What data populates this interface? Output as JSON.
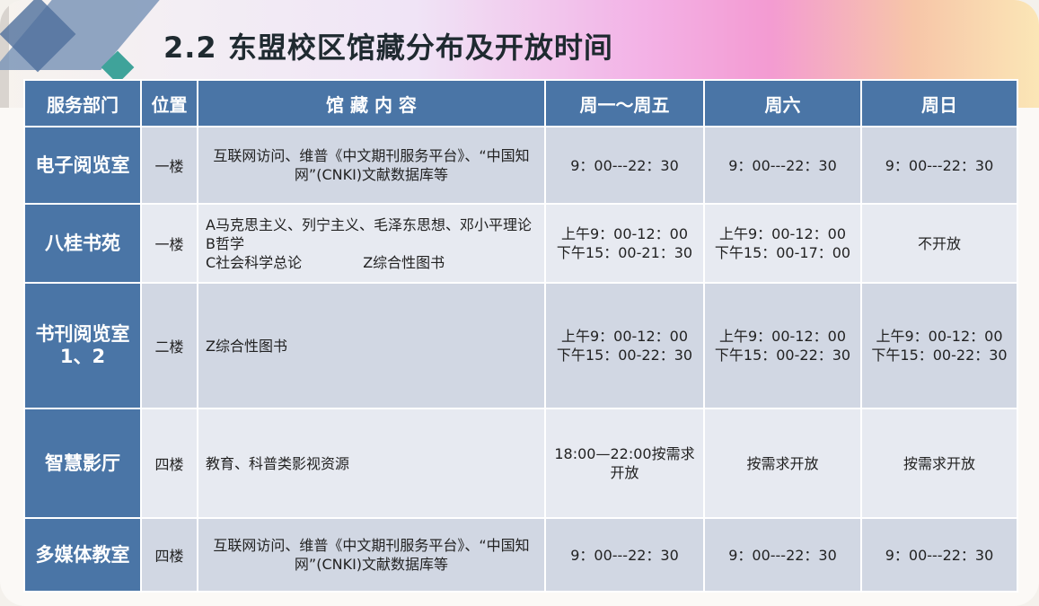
{
  "title": "2.2 东盟校区馆藏分布及开放时间",
  "headers": [
    "服务部门",
    "位置",
    "馆 藏 内 容",
    "周一～周五",
    "周六",
    "周日"
  ],
  "rows": [
    {
      "dept": "电子阅览室",
      "location": "一楼",
      "content": "互联网访问、维普《中文期刊服务平台》、“中国知网”(CNKI)文献数据库等",
      "weekday": "9：00---22：30",
      "saturday": "9：00---22：30",
      "sunday": "9：00---22：30"
    },
    {
      "dept": "八桂书苑",
      "location": "一楼",
      "content_lines": [
        "A马克思主义、列宁主义、毛泽东思想、邓小平理论",
        "B哲学",
        "C社会科学总论",
        "Z综合性图书"
      ],
      "weekday": [
        "上午9：00-12：00",
        "下午15：00-21：30"
      ],
      "saturday": [
        "上午9：00-12：00",
        "下午15：00-17：00"
      ],
      "sunday": "不开放"
    },
    {
      "dept_lines": [
        "书刊阅览室",
        "1、2"
      ],
      "location": "二楼",
      "content": "Z综合性图书",
      "weekday": [
        "上午9：00-12：00",
        "下午15：00-22：30"
      ],
      "saturday": [
        "上午9：00-12：00",
        "下午15：00-22：30"
      ],
      "sunday": [
        "上午9：00-12：00",
        "下午15：00-22：30"
      ]
    },
    {
      "dept": "智慧影厅",
      "location": "四楼",
      "content": "教育、科普类影视资源",
      "weekday": "18:00—22:00按需求开放",
      "saturday": "按需求开放",
      "sunday": "按需求开放"
    },
    {
      "dept": "多媒体教室",
      "location": "四楼",
      "content": "互联网访问、维普《中文期刊服务平台》、“中国知网”(CNKI)文献数据库等",
      "weekday": "9：00---22：30",
      "saturday": "9：00---22：30",
      "sunday": "9：00---22：30"
    }
  ],
  "colors": {
    "header_bg": "#4a75a6",
    "row_odd": "#d1d7e3",
    "row_even": "#e7eaf1"
  }
}
